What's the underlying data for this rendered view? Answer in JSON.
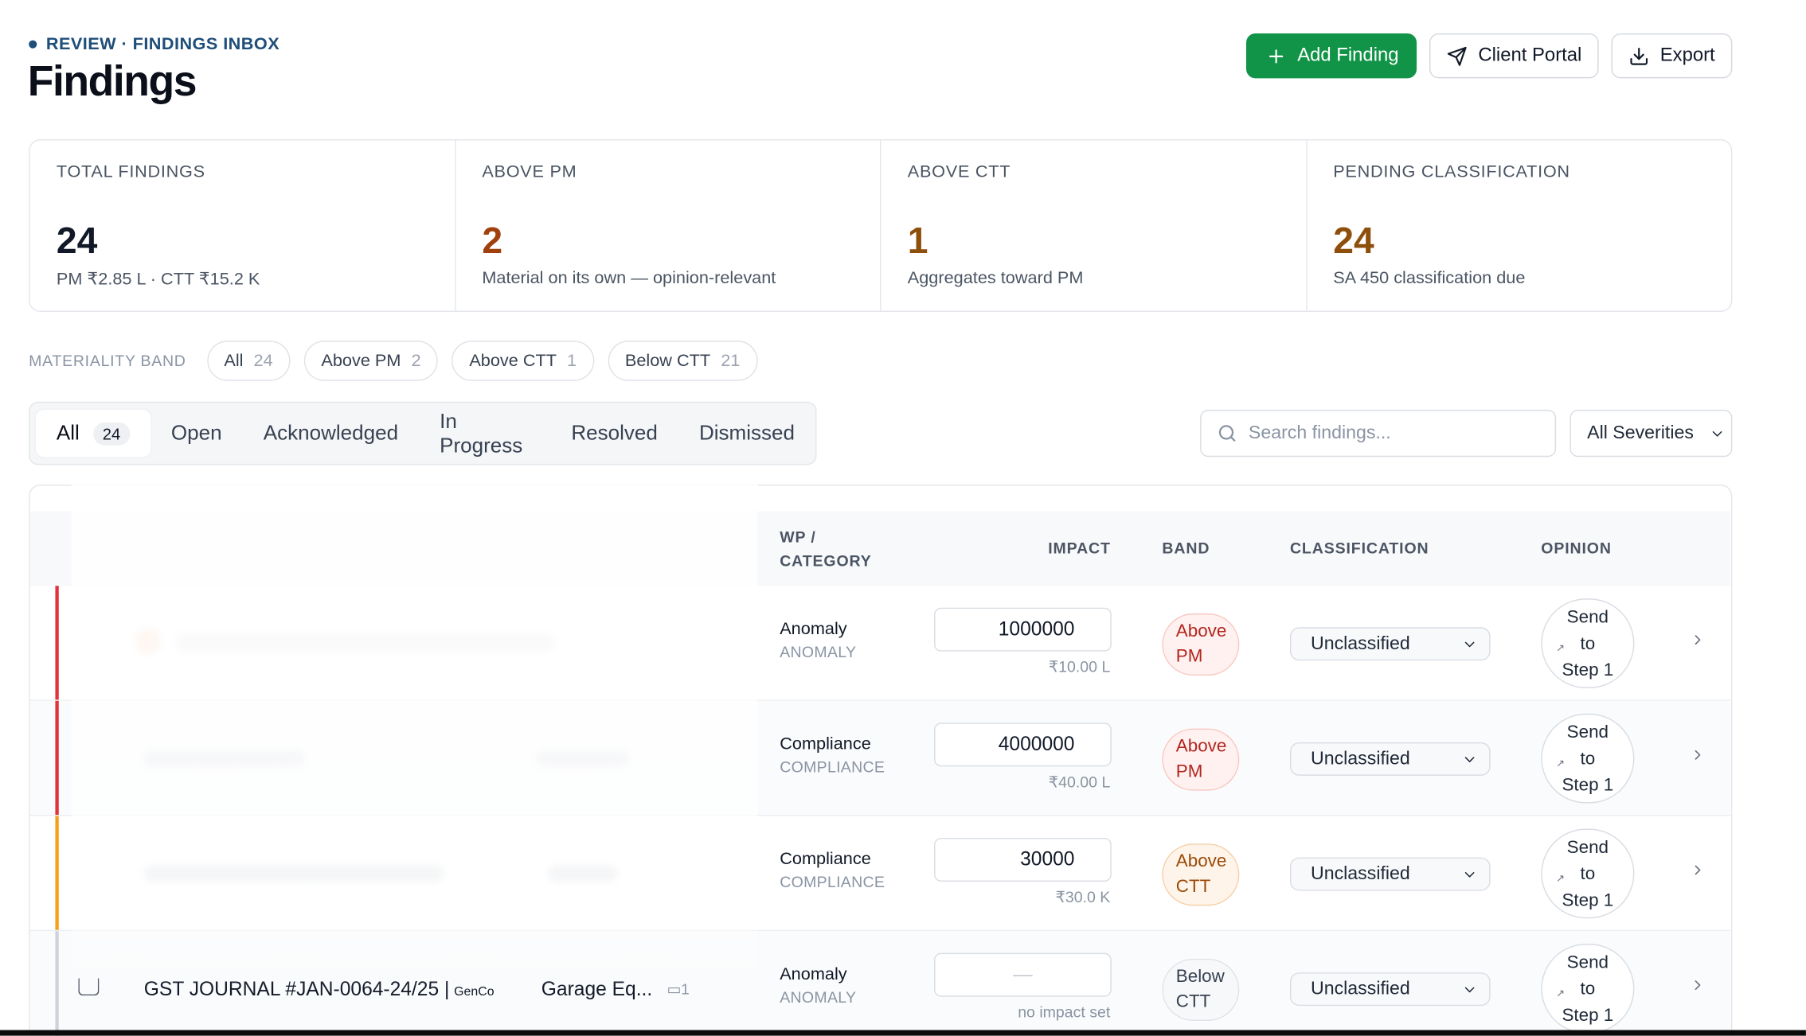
{
  "header": {
    "eyebrow": "REVIEW · FINDINGS INBOX",
    "title": "Findings"
  },
  "actions": {
    "add": "Add Finding",
    "portal": "Client Portal",
    "export": "Export"
  },
  "stats": [
    {
      "label": "TOTAL FINDINGS",
      "value": "24",
      "sub": "PM ₹2.85 L · CTT ₹15.2 K"
    },
    {
      "label": "ABOVE PM",
      "value": "2",
      "sub": "Material on its own — opinion-relevant"
    },
    {
      "label": "ABOVE CTT",
      "value": "1",
      "sub": "Aggregates toward PM"
    },
    {
      "label": "PENDING CLASSIFICATION",
      "value": "24",
      "sub": "SA 450 classification due"
    }
  ],
  "band_filter": {
    "label": "MATERIALITY BAND",
    "pills": [
      {
        "label": "All",
        "count": "24"
      },
      {
        "label": "Above PM",
        "count": "2"
      },
      {
        "label": "Above CTT",
        "count": "1"
      },
      {
        "label": "Below CTT",
        "count": "21"
      }
    ]
  },
  "tabs": [
    {
      "label": "All",
      "badge": "24"
    },
    {
      "label": "Open"
    },
    {
      "label": "Acknowledged"
    },
    {
      "label": "In Progress"
    },
    {
      "label": "Resolved"
    },
    {
      "label": "Dismissed"
    }
  ],
  "search": {
    "placeholder": "Search findings..."
  },
  "severity": {
    "selected": "All Severities"
  },
  "table": {
    "columns": {
      "wp": "WP /",
      "wp2": "CATEGORY",
      "impact": "IMPACT",
      "band": "BAND",
      "classification": "CLASSIFICATION",
      "opinion": "OPINION"
    }
  },
  "rows": [
    {
      "cat": "Anomaly",
      "cat_sub": "ANOMALY",
      "impact": "1000000",
      "impact_fmt": "₹10.00 L",
      "band1": "Above",
      "band2": "PM",
      "cls": "Unclassified",
      "accent": "#e2333d"
    },
    {
      "cat": "Compliance",
      "cat_sub": "COMPLIANCE",
      "impact": "4000000",
      "impact_fmt": "₹40.00 L",
      "band1": "Above",
      "band2": "PM",
      "cls": "Unclassified",
      "accent": "#e2333d"
    },
    {
      "cat": "Compliance",
      "cat_sub": "COMPLIANCE",
      "impact": "30000",
      "impact_fmt": "₹30.0 K",
      "band1": "Above",
      "band2": "CTT",
      "cls": "Unclassified",
      "accent": "#f59f1c"
    },
    {
      "title": "GST JOURNAL #JAN-0064-24/25 |",
      "client": "GenCo",
      "wp": "Garage Eq...",
      "comments": "1",
      "cat": "Anomaly",
      "cat_sub": "ANOMALY",
      "impact": "—",
      "impact_fmt": "no impact set",
      "band1": "Below",
      "band2": "CTT",
      "cls": "Unclassified",
      "accent": "#cfd3d9"
    }
  ],
  "opinion": {
    "l1": "Send",
    "l2": "to",
    "l3": "Step 1"
  }
}
